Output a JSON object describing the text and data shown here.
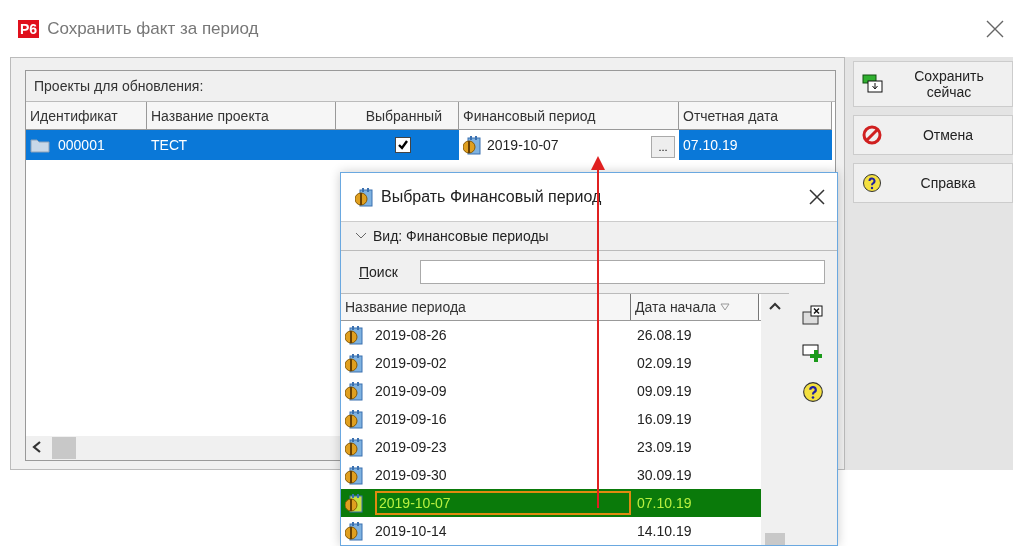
{
  "window": {
    "badge": "P6",
    "title": "Сохранить факт за период"
  },
  "projects": {
    "title": "Проекты для обновления:",
    "columns": [
      "Идентификат",
      "Название проекта",
      "Выбранный",
      "Финансовый период",
      "Отчетная дата"
    ],
    "rows": [
      {
        "id": "000001",
        "name": "ТЕСТ",
        "checked": true,
        "period": "2019-10-07",
        "period_button": "...",
        "report_date": "07.10.19",
        "selected": true
      }
    ]
  },
  "buttons": [
    {
      "kind": "save",
      "label": "Сохранить сейчас"
    },
    {
      "kind": "cancel",
      "label": "Отмена"
    },
    {
      "kind": "help",
      "label": "Справка"
    }
  ],
  "picker": {
    "title": "Выбрать Финансовый период",
    "view": "Вид: Финансовые периоды",
    "search_label": "Поиск",
    "columns": [
      "Название периода",
      "Дата начала"
    ],
    "rows": [
      {
        "name": "2019-08-26",
        "start": "26.08.19",
        "selected": false
      },
      {
        "name": "2019-09-02",
        "start": "02.09.19",
        "selected": false
      },
      {
        "name": "2019-09-09",
        "start": "09.09.19",
        "selected": false
      },
      {
        "name": "2019-09-16",
        "start": "16.09.19",
        "selected": false
      },
      {
        "name": "2019-09-23",
        "start": "23.09.19",
        "selected": false
      },
      {
        "name": "2019-09-30",
        "start": "30.09.19",
        "selected": false
      },
      {
        "name": "2019-10-07",
        "start": "07.10.19",
        "selected": true
      },
      {
        "name": "2019-10-14",
        "start": "14.10.19",
        "selected": false
      }
    ],
    "tools": [
      {
        "kind": "close-view"
      },
      {
        "kind": "add"
      },
      {
        "kind": "help"
      }
    ]
  }
}
